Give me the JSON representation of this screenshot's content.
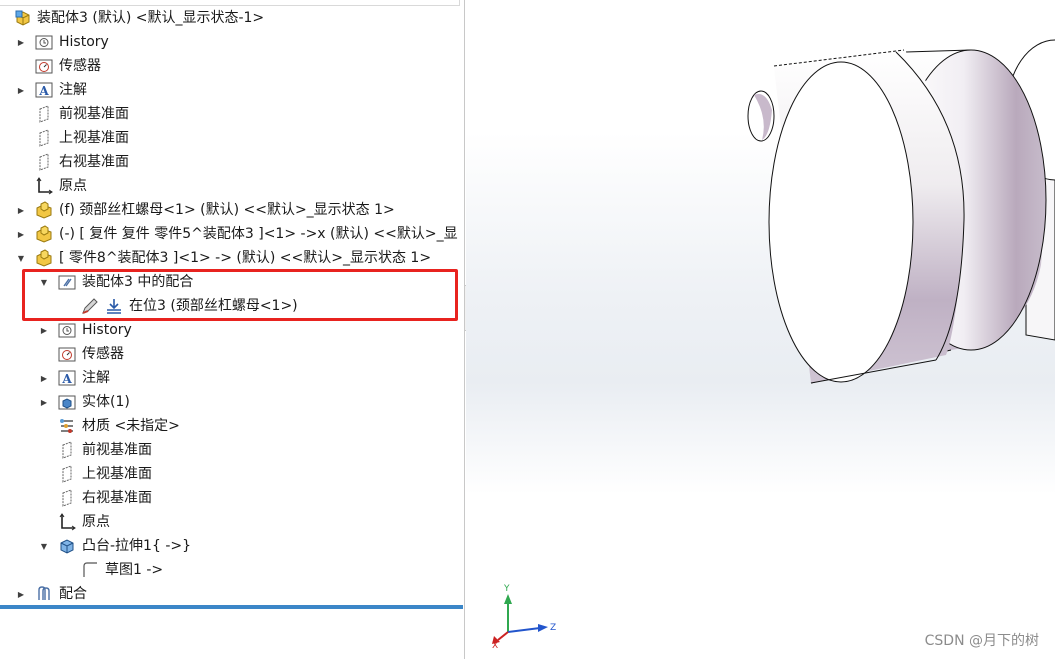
{
  "tree": {
    "root_label": "装配体3 (默认) <默认_显示状态-1>",
    "items": [
      {
        "label": "History"
      },
      {
        "label": "传感器"
      },
      {
        "label": "注解"
      },
      {
        "label": "前视基准面"
      },
      {
        "label": "上视基准面"
      },
      {
        "label": "右视基准面"
      },
      {
        "label": "原点"
      },
      {
        "label": "(f) 颈部丝杠螺母<1> (默认) <<默认>_显示状态 1>"
      },
      {
        "label": "(-) [ 复件 复件 零件5^装配体3 ]<1> ->x (默认) <<默认>_显"
      },
      {
        "label": "[ 零件8^装配体3 ]<1> -> (默认) <<默认>_显示状态 1>"
      },
      {
        "label": "装配体3 中的配合"
      },
      {
        "label": "在位3 (颈部丝杠螺母<1>)"
      },
      {
        "label": "History"
      },
      {
        "label": "传感器"
      },
      {
        "label": "注解"
      },
      {
        "label": "实体(1)"
      },
      {
        "label": "材质 <未指定>"
      },
      {
        "label": "前视基准面"
      },
      {
        "label": "上视基准面"
      },
      {
        "label": "右视基准面"
      },
      {
        "label": "原点"
      },
      {
        "label": "凸台-拉伸1{ ->}"
      },
      {
        "label": "草图1 ->"
      },
      {
        "label": "配合"
      }
    ]
  },
  "triad": {
    "y_label": "Y",
    "x_label": "X",
    "z_label": "Z"
  },
  "watermark": "CSDN @月下的树",
  "colors": {
    "highlight": "#e8231f",
    "accent_bar": "#3b86c8"
  }
}
